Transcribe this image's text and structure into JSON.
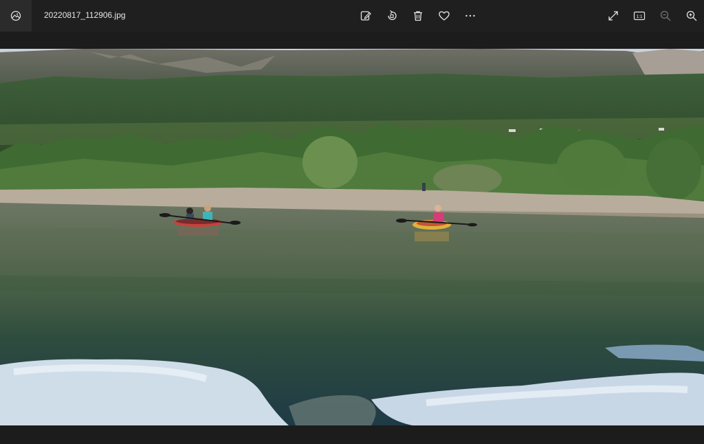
{
  "app": {
    "icon": "photos-app-icon"
  },
  "file": {
    "name": "20220817_112906.jpg"
  },
  "toolbar": {
    "center_icons": [
      "edit-image-icon",
      "rotate-icon",
      "delete-icon",
      "favorite-heart-icon",
      "more-options-icon"
    ],
    "right_icons": [
      "fullscreen-icon",
      "actual-size-icon",
      "zoom-out-icon",
      "zoom-in-icon"
    ],
    "actual_size_label": "1:1"
  },
  "photo": {
    "subject": "kayakers-on-mountain-lake-photo"
  }
}
